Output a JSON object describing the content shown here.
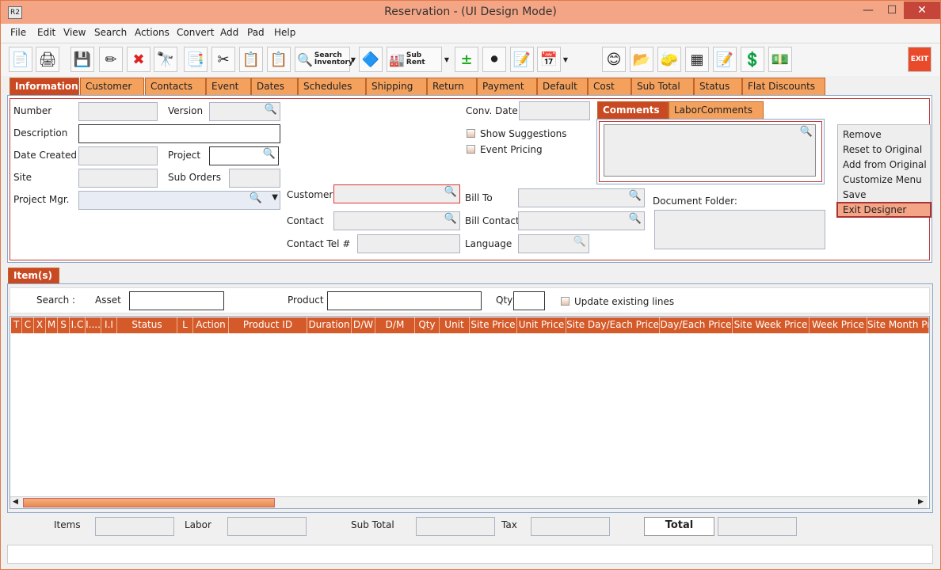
{
  "window": {
    "title": "Reservation - (UI Design Mode)",
    "app_icon": "R2",
    "minimize": "—",
    "maximize": "☐",
    "close": "✕"
  },
  "menu": [
    "File",
    "Edit",
    "View",
    "Search",
    "Actions",
    "Convert",
    "Add",
    "Pad",
    "Help"
  ],
  "toolbar": {
    "search_inventory_l1": "Search",
    "search_inventory_l2": "Inventory",
    "sub_rent": "Sub Rent",
    "exit": "EXIT"
  },
  "tabs": [
    "Information",
    "Customer",
    "Contacts",
    "Event",
    "Dates",
    "Schedules",
    "Shipping",
    "Return",
    "Payment",
    "Default",
    "Cost",
    "Sub Total",
    "Status",
    "Flat Discounts"
  ],
  "info": {
    "number_label": "Number",
    "version_label": "Version",
    "description_label": "Description",
    "date_created_label": "Date Created",
    "project_label": "Project",
    "site_label": "Site",
    "sub_orders_label": "Sub Orders",
    "project_mgr_label": "Project Mgr.",
    "conv_date_label": "Conv. Date",
    "show_suggestions": "Show Suggestions",
    "event_pricing": "Event Pricing",
    "customer_label": "Customer",
    "contact_label": "Contact",
    "contact_tel_label": "Contact Tel #",
    "bill_to_label": "Bill To",
    "bill_contact_label": "Bill Contact",
    "language_label": "Language",
    "document_folder_label": "Document Folder:"
  },
  "comment_tabs": [
    "Comments",
    "LaborComments"
  ],
  "context_menu": [
    "Remove",
    "Reset to Original",
    "Add from Original",
    "Customize Menu",
    "Save",
    "Exit Designer"
  ],
  "items": {
    "tab": "Item(s)",
    "search_label": "Search :",
    "asset_label": "Asset",
    "product_label": "Product",
    "qty_label": "Qty",
    "update_existing": "Update existing lines",
    "columns": [
      "T",
      "C",
      "X",
      "M",
      "S",
      "I.C",
      "I....",
      "I.I",
      "Status",
      "L",
      "Action",
      "Product ID",
      "Duration",
      "D/W",
      "D/M",
      "Qty",
      "Unit",
      "Site Price",
      "Unit Price",
      "Site Day/Each Price",
      "Day/Each Price",
      "Site Week Price",
      "Week Price",
      "Site Month Pr"
    ]
  },
  "totals": {
    "items_label": "Items",
    "labor_label": "Labor",
    "sub_total_label": "Sub Total",
    "tax_label": "Tax",
    "total_button": "Total"
  },
  "colors": {
    "accent": "#d55a29",
    "tab": "#f4a15e",
    "titlebar": "#f4a585",
    "border_red": "#c0393b"
  }
}
